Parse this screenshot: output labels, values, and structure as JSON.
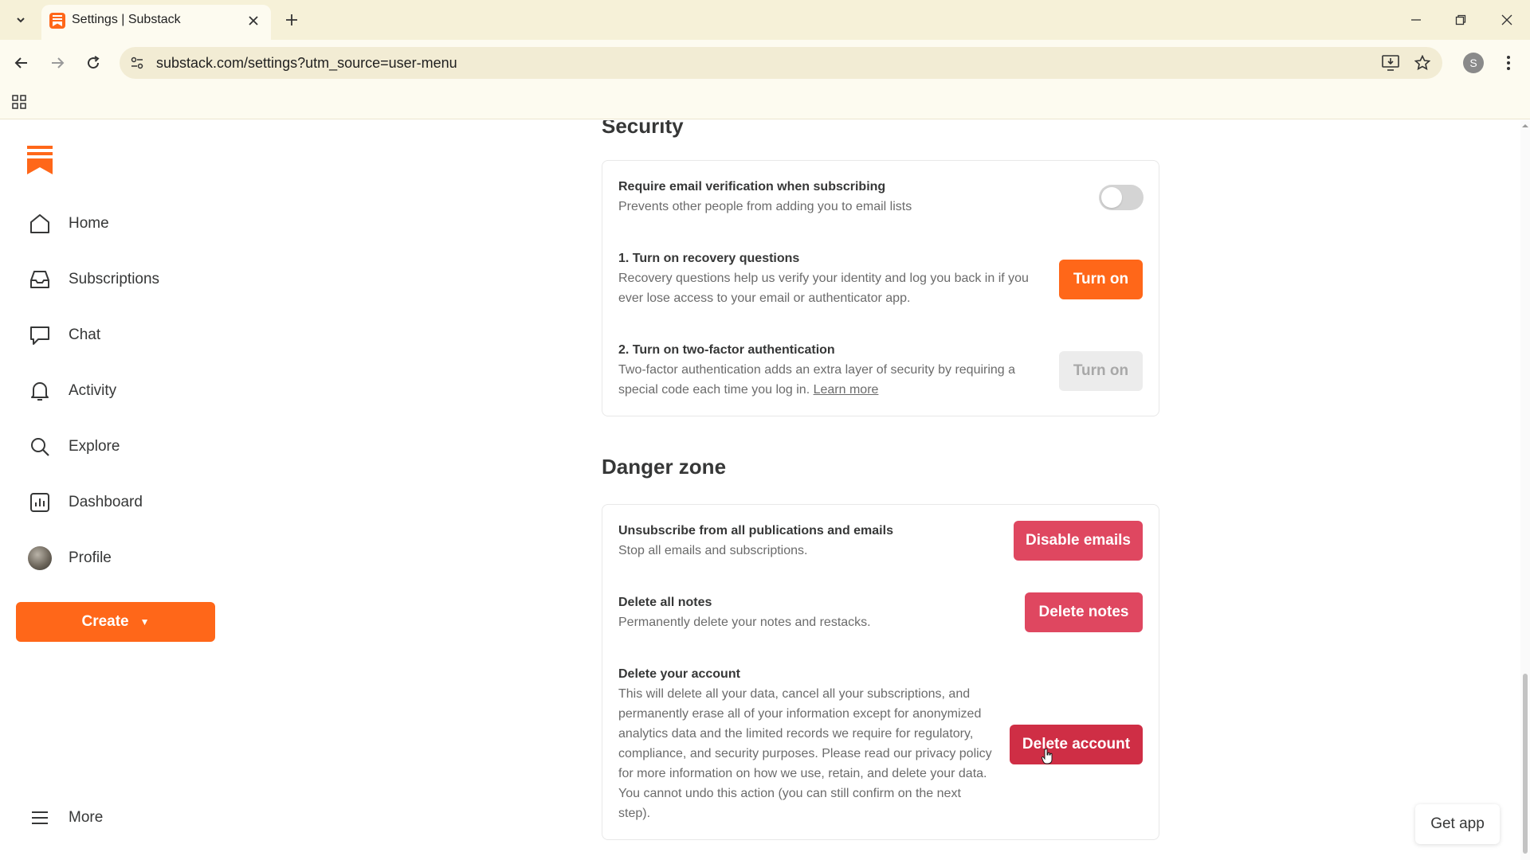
{
  "browser": {
    "tab_title": "Settings | Substack",
    "url": "substack.com/settings?utm_source=user-menu",
    "profile_initial": "S",
    "accent": "#ff6719"
  },
  "sidebar": {
    "items": [
      {
        "label": "Home",
        "icon": "home-icon"
      },
      {
        "label": "Subscriptions",
        "icon": "inbox-icon"
      },
      {
        "label": "Chat",
        "icon": "chat-icon"
      },
      {
        "label": "Activity",
        "icon": "bell-icon"
      },
      {
        "label": "Explore",
        "icon": "search-icon"
      },
      {
        "label": "Dashboard",
        "icon": "chart-icon"
      },
      {
        "label": "Profile",
        "icon": "avatar"
      }
    ],
    "create_label": "Create",
    "more_label": "More"
  },
  "security": {
    "title": "Security",
    "email_verification": {
      "title": "Require email verification when subscribing",
      "desc": "Prevents other people from adding you to email lists",
      "enabled": false
    },
    "recovery": {
      "title": "1. Turn on recovery questions",
      "desc_line1": "Recovery questions help us verify your identity and log you back in if you",
      "desc_line2": "ever lose access to your email or authenticator app.",
      "button": "Turn on"
    },
    "two_factor": {
      "title": "2. Turn on two-factor authentication",
      "desc_line1": "Two-factor authentication adds an extra layer of security by requiring a",
      "desc_line2": "special code each time you log in.",
      "link": "Learn more",
      "button": "Turn on"
    }
  },
  "danger": {
    "title": "Danger zone",
    "unsubscribe": {
      "title": "Unsubscribe from all publications and emails",
      "desc": "Stop all emails and subscriptions.",
      "button": "Disable emails"
    },
    "notes": {
      "title": "Delete all notes",
      "desc": "Permanently delete your notes and restacks.",
      "button": "Delete notes"
    },
    "account": {
      "title": "Delete your account",
      "desc_lines": [
        "This will delete all your data, cancel all your subscriptions, and",
        "permanently erase all of your information except for anonymized",
        "analytics data and the limited records we require for regulatory,",
        "compliance, and security purposes. Please read our privacy policy",
        "for more information on how we use, retain, and delete your data.",
        "You cannot undo this action (you can still confirm on the next",
        "step)."
      ],
      "button": "Delete account"
    }
  },
  "get_app_label": "Get app"
}
